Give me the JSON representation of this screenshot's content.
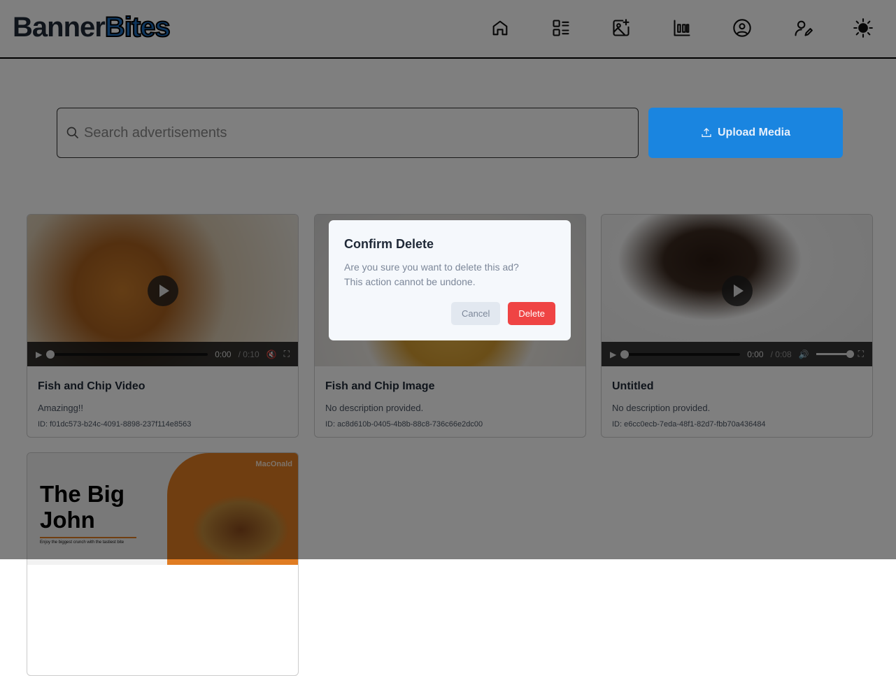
{
  "header": {
    "logo_part1": "Banner",
    "logo_part2": "Bites",
    "nav": [
      "home-icon",
      "list-icon",
      "image-add-icon",
      "bar-chart-icon",
      "user-circle-icon",
      "user-edit-icon",
      "sun-icon"
    ]
  },
  "search": {
    "placeholder": "Search advertisements",
    "value": ""
  },
  "upload": {
    "label": "Upload Media",
    "icon": "upload-icon"
  },
  "colors": {
    "accent": "#1a85e0",
    "danger": "#ef4444"
  },
  "cards": [
    {
      "title": "Fish and Chip Video",
      "description": "Amazingg!!",
      "id": "ID: f01dc573-b24c-4091-8898-237f114e8563",
      "type": "video",
      "time": "0:00",
      "duration": "/ 0:10",
      "muted": true
    },
    {
      "title": "Fish and Chip Image",
      "description": "No description provided.",
      "id": "ID: ac8d610b-0405-4b8b-88c8-736c66e2dc00",
      "type": "image"
    },
    {
      "title": "Untitled",
      "description": "No description provided.",
      "id": "ID: e6cc0ecb-7eda-48f1-82d7-fbb70a436484",
      "type": "video",
      "time": "0:00",
      "duration": "/ 0:08",
      "muted": false,
      "volume": 1.0
    },
    {
      "type": "image",
      "banner": {
        "headline1": "The Big",
        "headline2": "John",
        "tagline": "Enjoy the biggest crunch with the tastiest bite",
        "brand": "MacOnald"
      }
    }
  ],
  "dialog": {
    "title": "Confirm Delete",
    "message1": "Are you sure you want to delete this ad?",
    "message2": "This action cannot be undone.",
    "cancel": "Cancel",
    "delete": "Delete"
  }
}
